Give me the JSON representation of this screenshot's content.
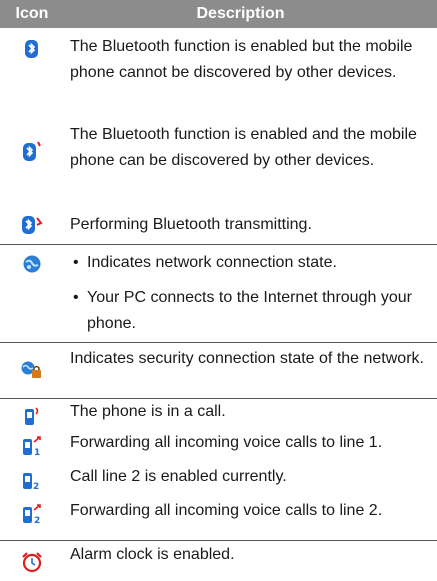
{
  "table": {
    "header": {
      "icon": "Icon",
      "description": "Description"
    },
    "rows": [
      {
        "icon": "bluetooth-hidden-icon",
        "text": "The Bluetooth function is enabled but the mobile phone cannot be discovered by other devices."
      },
      {
        "icon": "bluetooth-visible-icon",
        "text": "The Bluetooth function is enabled and the mobile phone can be discovered by other devices."
      },
      {
        "icon": "bluetooth-transmit-icon",
        "text": "Performing Bluetooth transmitting."
      },
      {
        "icon": "network-connection-icon",
        "bullets": [
          "Indicates network connection state.",
          "Your PC connects to the Internet through your phone."
        ]
      },
      {
        "icon": "security-connection-icon",
        "text": "Indicates security connection state of the network."
      },
      {
        "icon": "in-call-icon",
        "text": "The phone is in a call."
      },
      {
        "icon": "forward-line1-icon",
        "text": "Forwarding all incoming voice calls to line 1."
      },
      {
        "icon": "line2-enabled-icon",
        "text": "Call line 2 is enabled currently."
      },
      {
        "icon": "forward-line2-icon",
        "text": "Forwarding all incoming voice calls to line 2."
      },
      {
        "icon": "alarm-clock-icon",
        "text": "Alarm clock is enabled."
      }
    ]
  },
  "colors": {
    "header_bg": "#8c8c8c",
    "bluetooth": "#1f6fd1",
    "accent_red": "#e02020",
    "globe": "#2a7fd4",
    "lock": "#d47a1a"
  }
}
